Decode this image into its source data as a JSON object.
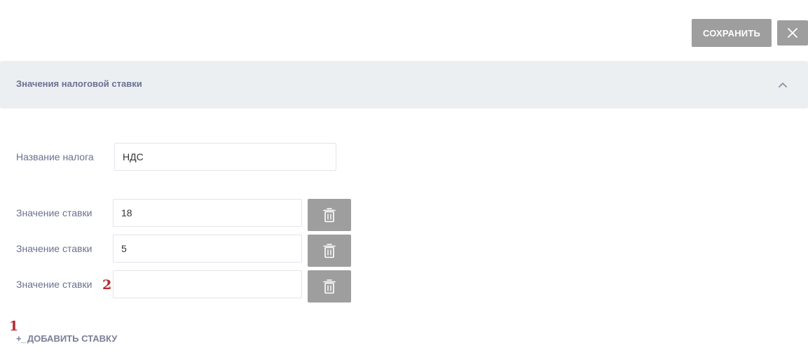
{
  "toolbar": {
    "save_label": "СОХРАНИТЬ",
    "close_icon": "close-icon"
  },
  "section": {
    "title": "Значения налоговой ставки",
    "toggle_icon": "chevron-up-icon",
    "background": "#eceff1"
  },
  "form": {
    "tax_name": {
      "label": "Название налога",
      "value": "НДС"
    },
    "rates": [
      {
        "label": "Значение ставки",
        "value": "18"
      },
      {
        "label": "Значение ставки",
        "value": "5"
      },
      {
        "label": "Значение ставки",
        "value": ""
      }
    ],
    "delete_icon": "trash-icon",
    "add_prefix": "+_",
    "add_label": "ДОБАВИТЬ СТАВКУ"
  },
  "annotations": {
    "marker_1": "1",
    "marker_2": "2",
    "color": "#b52a2f"
  },
  "colors": {
    "button_gray": "#9e9e9e",
    "label_text": "#6b7090"
  }
}
